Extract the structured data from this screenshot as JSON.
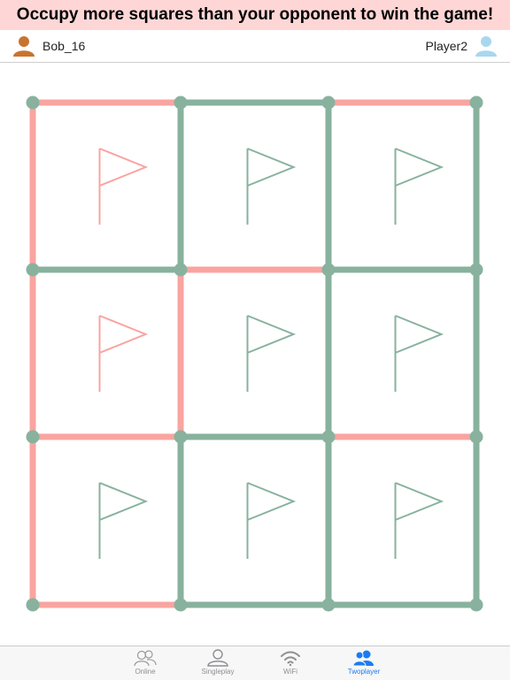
{
  "banner": {
    "text": "Occupy more squares than your opponent to win the game!"
  },
  "players": {
    "left": {
      "name": "Bob_16",
      "icon": "avatar-icon",
      "color": "#c8742f"
    },
    "right": {
      "name": "Player2",
      "icon": "avatar-icon",
      "color": "#a9d7ee"
    }
  },
  "board": {
    "rows": 3,
    "cols": 3,
    "colors": {
      "pink": "#f9a4a0",
      "green": "#88b29e"
    },
    "h_edges": [
      [
        "pink",
        "green",
        "pink"
      ],
      [
        "green",
        "pink",
        "green"
      ],
      [
        "pink",
        "green",
        "pink"
      ],
      [
        "pink",
        "green",
        "green"
      ]
    ],
    "v_edges": [
      [
        "pink",
        "green",
        "green",
        "green"
      ],
      [
        "pink",
        "pink",
        "green",
        "green"
      ],
      [
        "pink",
        "green",
        "green",
        "green"
      ]
    ],
    "squares": [
      [
        "pink",
        "green",
        "green"
      ],
      [
        "pink",
        "green",
        "green"
      ],
      [
        "green",
        "green",
        "green"
      ]
    ]
  },
  "tabs": [
    {
      "label": "Online",
      "icon": "online-people-icon",
      "active": false
    },
    {
      "label": "Singleplay",
      "icon": "single-person-icon",
      "active": false
    },
    {
      "label": "WiFi",
      "icon": "wifi-icon",
      "active": false
    },
    {
      "label": "Twoplayer",
      "icon": "two-players-icon",
      "active": true
    }
  ]
}
